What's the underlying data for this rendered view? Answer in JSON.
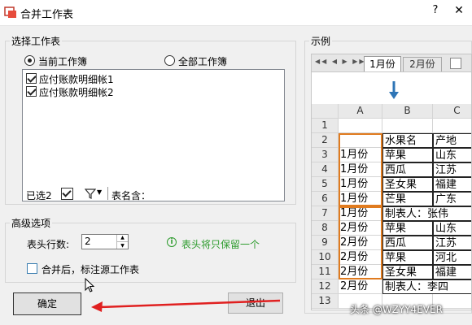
{
  "window": {
    "title": "合并工作表",
    "help": "?",
    "close": "✕"
  },
  "select_group": {
    "title": "选择工作表",
    "radio_current": "当前工作簿",
    "radio_all": "全部工作簿",
    "sheets": [
      {
        "label": "应付账款明细帐1",
        "checked": true
      },
      {
        "label": "应付账款明细帐2",
        "checked": true
      }
    ],
    "selected_count": "已选2",
    "sheet_name_label": "表名含："
  },
  "advanced_group": {
    "title": "高级选项",
    "header_rows_label": "表头行数:",
    "header_rows_value": "2",
    "info_text": "表头将只保留一个",
    "mark_source_label": "合并后，标注源工作表"
  },
  "buttons": {
    "ok": "确定",
    "exit": "退出"
  },
  "example": {
    "title": "示例",
    "tabs": [
      "1月份",
      "2月份"
    ],
    "col_headers": [
      "A",
      "B",
      "C"
    ],
    "rows": [
      {
        "n": "1",
        "a": "",
        "b": "",
        "c": ""
      },
      {
        "n": "2",
        "a": "",
        "b": "水果名",
        "c": "产地"
      },
      {
        "n": "3",
        "a": "1月份",
        "b": "苹果",
        "c": "山东"
      },
      {
        "n": "4",
        "a": "1月份",
        "b": "西瓜",
        "c": "江苏"
      },
      {
        "n": "5",
        "a": "1月份",
        "b": "圣女果",
        "c": "福建"
      },
      {
        "n": "6",
        "a": "1月份",
        "b": "芒果",
        "c": "广东"
      },
      {
        "n": "7",
        "a": "1月份",
        "b": "制表人：张伟",
        "c": ""
      },
      {
        "n": "8",
        "a": "2月份",
        "b": "苹果",
        "c": "山东"
      },
      {
        "n": "9",
        "a": "2月份",
        "b": "西瓜",
        "c": "江苏"
      },
      {
        "n": "10",
        "a": "2月份",
        "b": "苹果",
        "c": "河北"
      },
      {
        "n": "11",
        "a": "2月份",
        "b": "圣女果",
        "c": "福建"
      },
      {
        "n": "12",
        "a": "2月份",
        "b": "制表人：李四",
        "c": ""
      },
      {
        "n": "13",
        "a": "",
        "b": "",
        "c": ""
      }
    ]
  },
  "watermark": "头条 @WZYY4EVER",
  "colors": {
    "accent": "#2e75b6",
    "orange_box": "#e07b1f",
    "red_arrow": "#e02020",
    "info_green": "#2d9b2d"
  }
}
